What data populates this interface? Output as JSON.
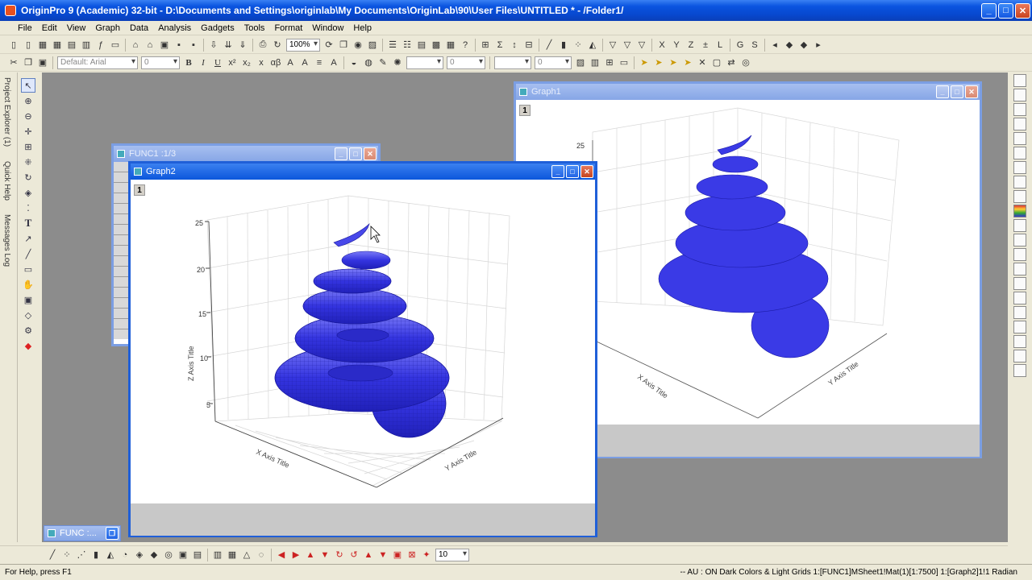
{
  "app": {
    "title": "OriginPro 9 (Academic) 32-bit - D:\\Documents and Settings\\originlab\\My Documents\\OriginLab\\90\\User Files\\UNTITLED * - /Folder1/"
  },
  "menu": [
    "File",
    "Edit",
    "View",
    "Graph",
    "Data",
    "Analysis",
    "Gadgets",
    "Tools",
    "Format",
    "Window",
    "Help"
  ],
  "toolbar": {
    "zoom": "100%",
    "font_name": "Default: Arial",
    "font_size": "0",
    "line_width": "0",
    "size_value": "0",
    "bottom_value": "10"
  },
  "left_dock": {
    "tabs": [
      "Project Explorer (1)",
      "Quick Help",
      "Messages Log"
    ]
  },
  "windows": {
    "func1": {
      "title": "FUNC1 :1/3"
    },
    "graph1": {
      "title": "Graph1",
      "layer": "1"
    },
    "graph2": {
      "title": "Graph2",
      "layer": "1"
    },
    "minimized": {
      "title": "FUNC :..."
    }
  },
  "plot": {
    "z_label": "Z Axis Title",
    "x_label": "X Axis Title",
    "y_label": "Y Axis Title",
    "z_ticks": [
      "5",
      "10",
      "15",
      "20",
      "25"
    ],
    "surface_color": "#3a3ae6"
  },
  "status": {
    "left": "For Help, press F1",
    "right": "-- AU : ON  Dark Colors & Light Grids  1:[FUNC1]MSheet1!Mat(1)[1:7500]  1:[Graph2]1!1  Radian"
  }
}
